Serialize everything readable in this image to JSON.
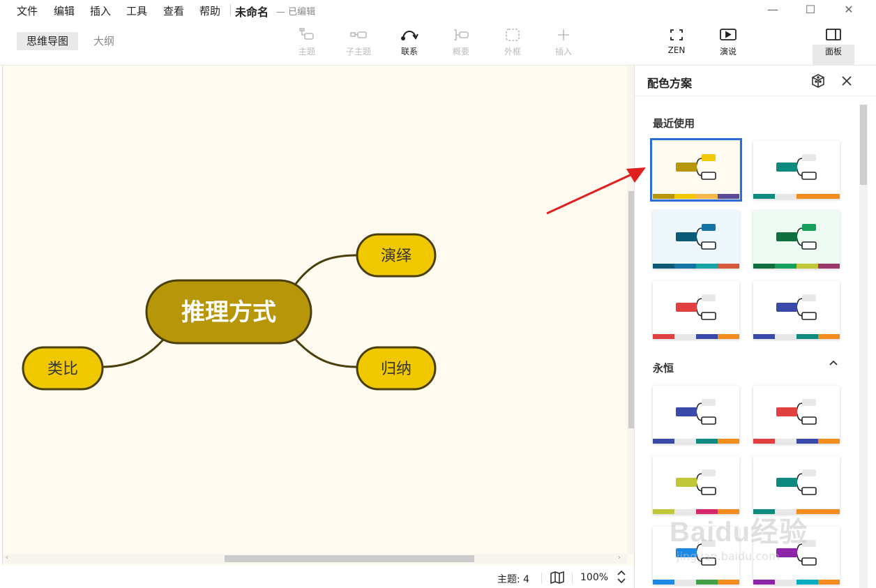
{
  "menu": [
    "文件",
    "编辑",
    "插入",
    "工具",
    "查看",
    "帮助"
  ],
  "window": {
    "title": "未命名",
    "status": "— 已编辑",
    "minimize": "—",
    "maximize": "☐",
    "close": "✕"
  },
  "view_tabs": {
    "mindmap": "思维导图",
    "outline": "大纲"
  },
  "toolbar": {
    "topic": "主题",
    "subtopic": "子主题",
    "relationship": "联系",
    "summary": "概要",
    "boundary": "外框",
    "insert": "插入",
    "zen": "ZEN",
    "present": "演说",
    "panel": "面板"
  },
  "mindmap": {
    "central": "推理方式",
    "branches": [
      "演绎",
      "归纳",
      "类比"
    ],
    "colors": {
      "central_fill": "#b8960a",
      "branch_fill": "#f0c800",
      "border": "#4a3f0a",
      "line": "#4a3f0a"
    }
  },
  "status": {
    "topic_count": "主题: 4",
    "zoom": "100%"
  },
  "panel": {
    "title": "配色方案",
    "sections": {
      "recent": "最近使用",
      "eternal": "永恒"
    },
    "recent_swatches": [
      {
        "bg": "#fffbf0",
        "main": "#b8960a",
        "top": "#f0c800",
        "bars": [
          "#b8960a",
          "#f0c800",
          "#f5b84a",
          "#5a4a9a"
        ]
      },
      {
        "bg": "#ffffff",
        "main": "#0e8a7e",
        "top": "#e8e8e8",
        "bars": [
          "#0e8a7e",
          "#e8e8e8",
          "#f28c1c",
          "#f28c1c"
        ]
      },
      {
        "bg": "#eef7fb",
        "main": "#0d5a77",
        "top": "#1474a6",
        "bars": [
          "#0d5a77",
          "#1474a6",
          "#17a3a3",
          "#d45a3a"
        ]
      },
      {
        "bg": "#edfbf2",
        "main": "#0f6e3e",
        "top": "#16a05e",
        "bars": [
          "#0f6e3e",
          "#16a05e",
          "#c0c83a",
          "#9a3a6a"
        ]
      },
      {
        "bg": "#ffffff",
        "main": "#e04040",
        "top": "#e8e8e8",
        "bars": [
          "#e04040",
          "#e8e8e8",
          "#3a4aa8",
          "#f28c1c"
        ]
      },
      {
        "bg": "#ffffff",
        "main": "#3a4aa8",
        "top": "#e8e8e8",
        "bars": [
          "#3a4aa8",
          "#e8e8e8",
          "#0e8a7e",
          "#f28c1c"
        ]
      }
    ],
    "eternal_swatches": [
      {
        "bg": "#ffffff",
        "main": "#3a4aa8",
        "top": "#e8e8e8",
        "bars": [
          "#3a4aa8",
          "#e8e8e8",
          "#0e8a7e",
          "#f28c1c"
        ]
      },
      {
        "bg": "#ffffff",
        "main": "#e04040",
        "top": "#e8e8e8",
        "bars": [
          "#e04040",
          "#e8e8e8",
          "#3a4aa8",
          "#f28c1c"
        ]
      },
      {
        "bg": "#ffffff",
        "main": "#c0c83a",
        "top": "#e8e8e8",
        "bars": [
          "#c0c83a",
          "#e8e8e8",
          "#d4286a",
          "#f28c1c"
        ]
      },
      {
        "bg": "#ffffff",
        "main": "#0e8a7e",
        "top": "#e8e8e8",
        "bars": [
          "#0e8a7e",
          "#e8e8e8",
          "#f28c1c",
          "#f28c1c"
        ]
      },
      {
        "bg": "#ffffff",
        "main": "#1e88e5",
        "top": "#e8e8e8",
        "bars": [
          "#1e88e5",
          "#e8e8e8",
          "#43a047",
          "#f28c1c"
        ]
      },
      {
        "bg": "#ffffff",
        "main": "#8e24aa",
        "top": "#e8e8e8",
        "bars": [
          "#8e24aa",
          "#e8e8e8",
          "#00acc1",
          "#f28c1c"
        ]
      }
    ]
  },
  "watermark": {
    "text": "Baidu经验",
    "url": "jingyan.baidu.com"
  }
}
